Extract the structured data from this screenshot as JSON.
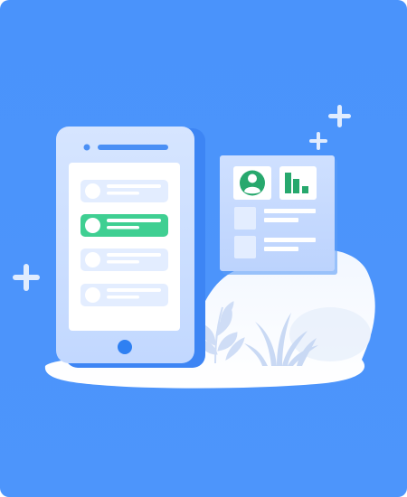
{
  "illustration": {
    "kind": "mobile-app-illustration",
    "colors": {
      "background": "#4A93FB",
      "accent_green": "#3FCF92",
      "accent_green_dark": "#27A86D",
      "card_light": "#E7F0FF",
      "card_mid": "#D8E6FF",
      "white": "#FFFFFF"
    },
    "phone": {
      "list_items": [
        {
          "state": "default"
        },
        {
          "state": "selected"
        },
        {
          "state": "default"
        },
        {
          "state": "default"
        }
      ],
      "home_button": "home-button"
    },
    "panel": {
      "tiles": [
        "user-avatar-icon",
        "bar-chart-icon"
      ],
      "rows": 2
    },
    "decorations": [
      "plus-icon",
      "plus-icon",
      "plus-icon",
      "leaf-plant",
      "grass-plant"
    ]
  }
}
